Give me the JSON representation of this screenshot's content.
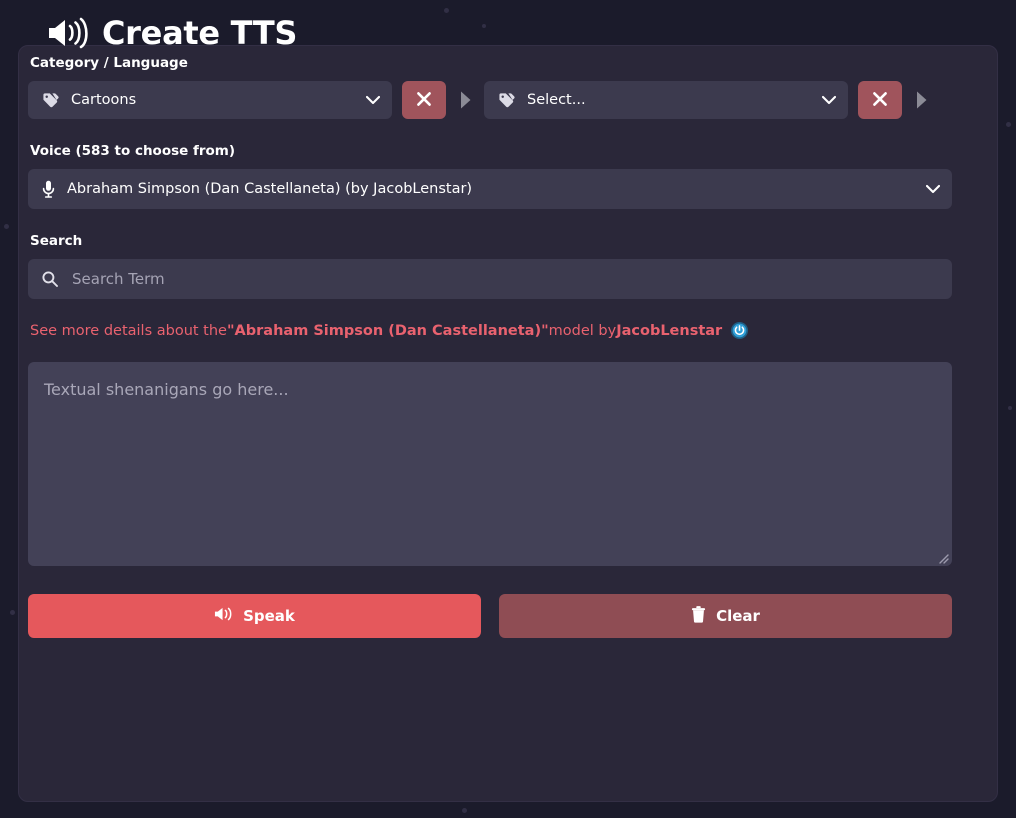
{
  "theme": {
    "page_bg": "#1b1b2b",
    "card_bg": "#2a2739",
    "input_bg": "#3c3a4e",
    "textarea_bg": "#434157",
    "accent_red": "#e5585c",
    "muted_red": "#8f4d54",
    "clear_btn_red": "#a0545c",
    "link_pink": "#e9626f",
    "arrow_gray": "#8b8b96",
    "badge_blue": "#2f9fd8"
  },
  "header": {
    "title": "Create TTS",
    "icon": "volume-up-icon"
  },
  "category": {
    "label": "Category / Language",
    "primary": {
      "icon": "tag-icon",
      "value": "Cartoons",
      "chevron": "chevron-down-icon",
      "clear_icon": "close-x-icon"
    },
    "secondary": {
      "icon": "tag-icon",
      "value": "Select...",
      "chevron": "chevron-down-icon",
      "clear_icon": "close-x-icon"
    },
    "separator_icon": "caret-right-icon"
  },
  "voice": {
    "label": "Voice (583 to choose from)",
    "count": 583,
    "icon": "microphone-icon",
    "value": "Abraham Simpson (Dan Castellaneta) (by JacobLenstar)",
    "chevron": "chevron-down-icon"
  },
  "search": {
    "label": "Search",
    "icon": "search-icon",
    "value": "",
    "placeholder": "Search Term"
  },
  "details": {
    "prefix": "See more details about the ",
    "quote_open": "\"",
    "model_name": "Abraham Simpson (Dan Castellaneta)",
    "quote_close": "\"",
    "middle": " model by ",
    "author": "JacobLenstar",
    "badge_icon": "power-badge-icon"
  },
  "textarea": {
    "value": "",
    "placeholder": "Textual shenanigans go here..."
  },
  "actions": {
    "speak": {
      "label": "Speak",
      "icon": "volume-up-icon"
    },
    "clear": {
      "label": "Clear",
      "icon": "trash-icon"
    }
  }
}
